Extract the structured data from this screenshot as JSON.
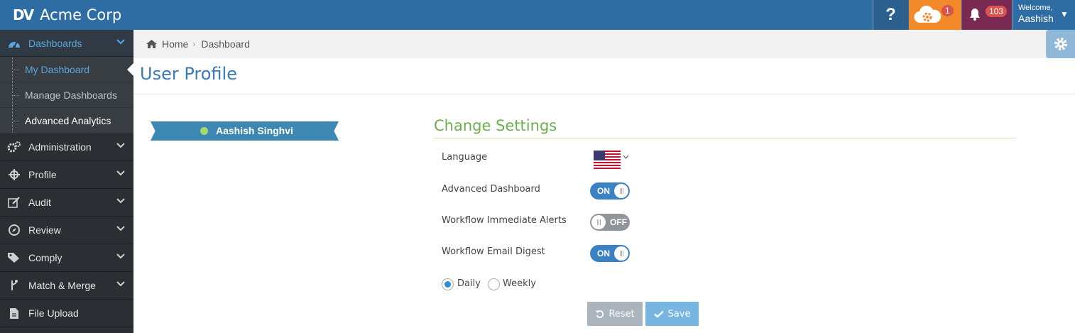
{
  "topbar": {
    "logo_text": "DV",
    "company": "Acme Corp",
    "help_glyph": "?",
    "cloud_badge": "1",
    "notifications_badge": "103",
    "welcome": "Welcome,",
    "user_name": "Aashish"
  },
  "sidebar": {
    "items": [
      {
        "label": "Dashboards",
        "icon": "dashboard-icon"
      },
      {
        "label": "Administration",
        "icon": "gears-icon"
      },
      {
        "label": "Profile",
        "icon": "crosshair-icon"
      },
      {
        "label": "Audit",
        "icon": "edit-icon"
      },
      {
        "label": "Review",
        "icon": "compass-icon"
      },
      {
        "label": "Comply",
        "icon": "tags-icon"
      },
      {
        "label": "Match & Merge",
        "icon": "merge-icon"
      },
      {
        "label": "File Upload",
        "icon": "file-icon"
      }
    ],
    "sub_items": [
      "My Dashboard",
      "Manage Dashboards",
      "Advanced Analytics"
    ]
  },
  "breadcrumb": {
    "home": "Home",
    "current": "Dashboard"
  },
  "page": {
    "title": "User Profile"
  },
  "profile": {
    "name": "Aashish  Singhvi",
    "status_color": "#a9d86e"
  },
  "settings": {
    "title": "Change Settings",
    "language_label": "Language",
    "language_flag": "us-flag-icon",
    "advanced_dashboard_label": "Advanced Dashboard",
    "advanced_dashboard_state": "ON",
    "workflow_alerts_label": "Workflow Immediate Alerts",
    "workflow_alerts_state": "OFF",
    "email_digest_label": "Workflow Email Digest",
    "email_digest_state": "ON",
    "digest_options": [
      "Daily",
      "Weekly"
    ],
    "digest_selected": "Daily",
    "reset_label": "Reset",
    "save_label": "Save"
  },
  "colors": {
    "topbar": "#2e6da4",
    "accent_green": "#6ab04c",
    "toggle_on": "#3b82c4",
    "cloud_tile": "#f28a2a",
    "bell_tile": "#7a2a52"
  }
}
